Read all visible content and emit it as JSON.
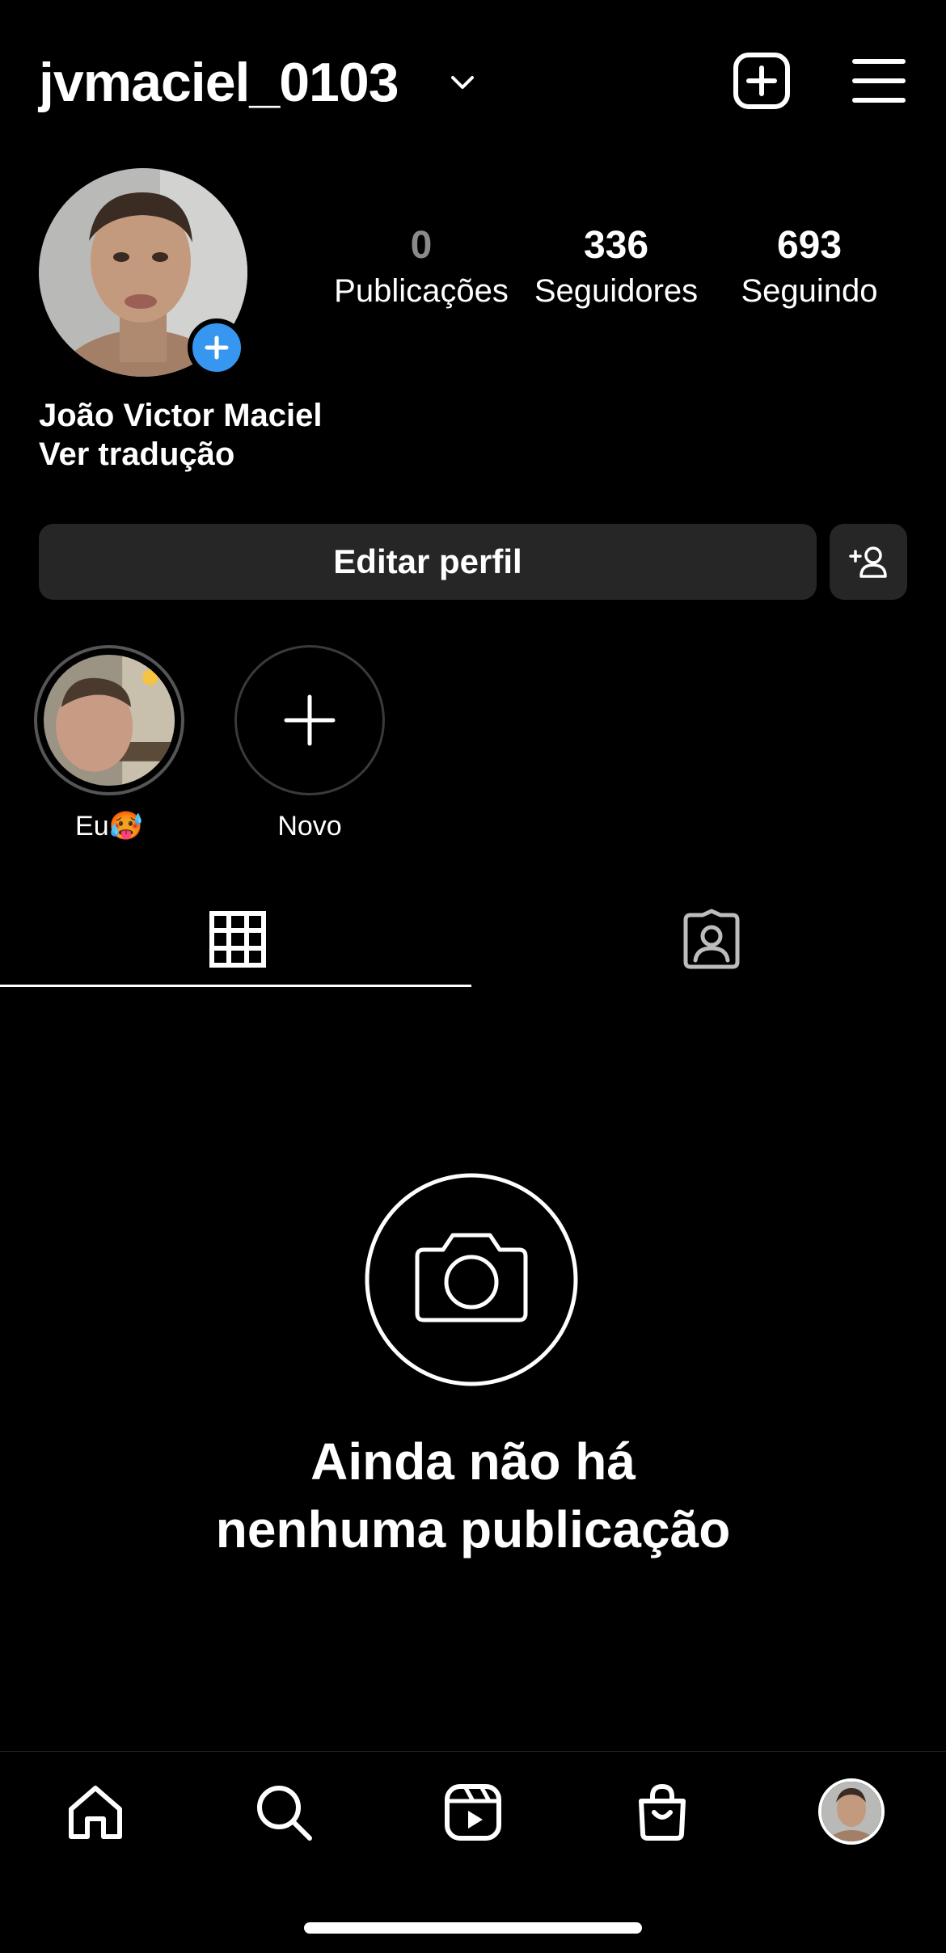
{
  "header": {
    "username": "jvmaciel_0103"
  },
  "profile": {
    "full_name": "João Victor Maciel",
    "translate_link": "Ver tradução",
    "stats": [
      {
        "value": "0",
        "label": "Publicações"
      },
      {
        "value": "336",
        "label": "Seguidores"
      },
      {
        "value": "693",
        "label": "Seguindo"
      }
    ]
  },
  "actions": {
    "edit_profile_label": "Editar perfil"
  },
  "highlights": [
    {
      "label": "Eu🥵"
    },
    {
      "label": "Novo"
    }
  ],
  "empty_state": {
    "line1": "Ainda não há",
    "line2": "nenhuma publicação"
  },
  "icons": {
    "header": [
      "chevron-down-icon",
      "new-post-icon",
      "menu-icon"
    ],
    "tabs": [
      "grid-icon",
      "tagged-icon"
    ],
    "nav": [
      "home-icon",
      "search-icon",
      "reels-icon",
      "shop-icon",
      "profile-avatar"
    ]
  },
  "colors": {
    "background": "#000000",
    "surface": "#262626",
    "accent": "#3797f0",
    "muted": "#8a8a8a"
  }
}
